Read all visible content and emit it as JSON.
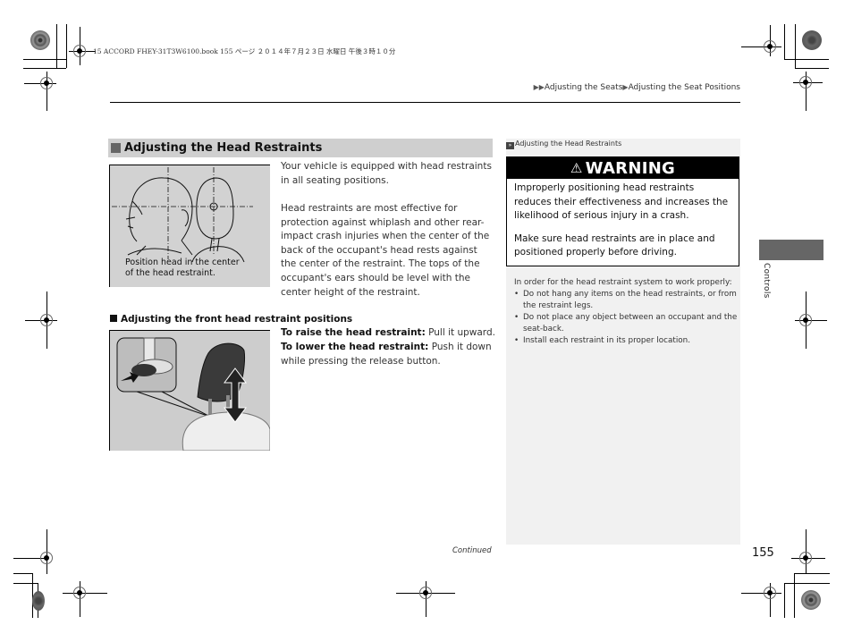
{
  "print_job_line": "15 ACCORD FHEY-31T3W6100.book  155 ページ  ２０１４年７月２３日  水曜日  午後３時１０分",
  "breadcrumb": {
    "arrows": "▶▶",
    "level1": "Adjusting the Seats",
    "sep": "▶",
    "level2": "Adjusting the Seat Positions"
  },
  "section": {
    "title": "Adjusting the Head Restraints",
    "figure1_caption_line1": "Position head in the center",
    "figure1_caption_line2": "of the head restraint.",
    "intro_paragraph": "Your vehicle is equipped with head restraints in all seating positions.",
    "effectiveness_paragraph": "Head restraints are most effective for protection against whiplash and other rear-impact crash injuries when the center of the back of the occupant's head rests against the center of the restraint. The tops of the occupant's ears should be level with the center height of the restraint."
  },
  "subsection": {
    "title": "Adjusting the front head restraint positions",
    "raise_label": "To raise the head restraint:",
    "raise_text": " Pull it upward.",
    "lower_label": "To lower the head restraint:",
    "lower_text": " Push it down while pressing the release button."
  },
  "sidebar": {
    "reference_icon": "»",
    "reference_title": "Adjusting the Head Restraints",
    "warning": {
      "icon": "⚠",
      "title": "WARNING",
      "paragraph1": "Improperly positioning head restraints reduces their effectiveness and increases the likelihood of serious injury in a crash.",
      "paragraph2": "Make sure head restraints are in place and positioned properly before driving."
    },
    "notes_intro": "In order for the head restraint system to work properly:",
    "notes": [
      "Do not hang any items on the head restraints, or from the restraint legs.",
      "Do not place any object between an occupant and the seat-back.",
      "Install each restraint in its proper location."
    ]
  },
  "chapter_tab": {
    "label": "Controls",
    "color": "#666666"
  },
  "footer": {
    "continued": "Continued",
    "page_number": "155"
  }
}
